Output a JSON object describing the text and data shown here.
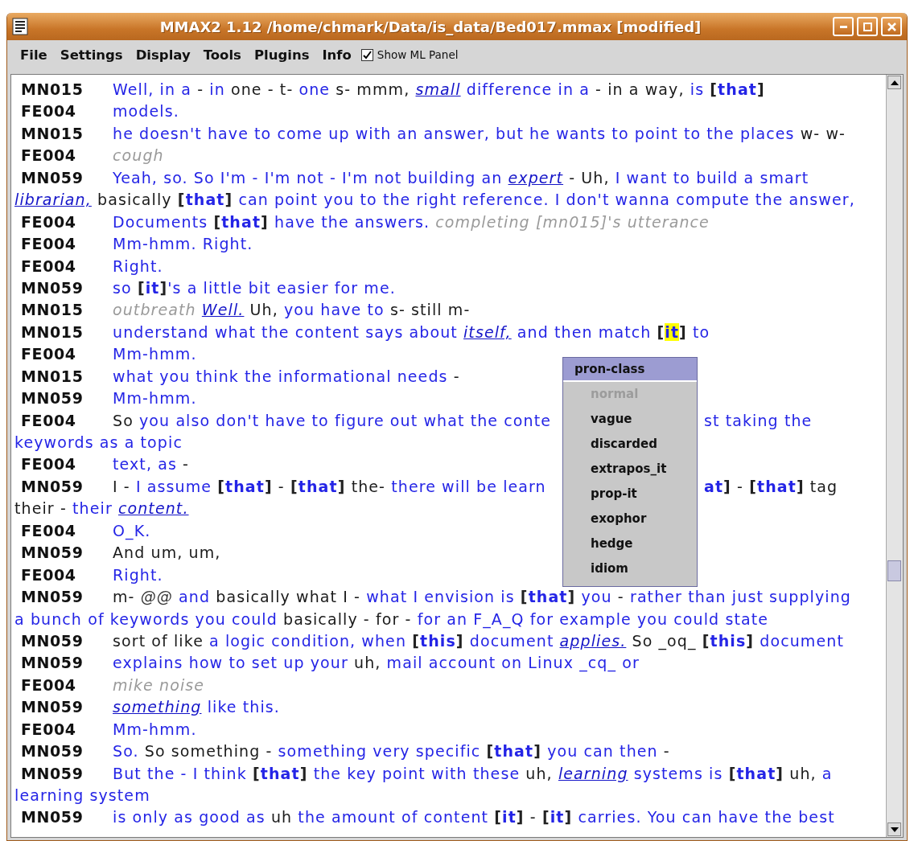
{
  "window": {
    "title": "MMAX2 1.12 /home/chmark/Data/is_data/Bed017.mmax [modified]"
  },
  "menu": [
    {
      "label": "File"
    },
    {
      "label": "Settings"
    },
    {
      "label": "Display"
    },
    {
      "label": "Tools"
    },
    {
      "label": "Plugins"
    },
    {
      "label": "Info"
    }
  ],
  "show_ml_panel": {
    "label": "Show ML Panel",
    "checked": true
  },
  "transcript": [
    {
      "speaker": "MN015",
      "segments": [
        {
          "kind": "speech",
          "text": "Well, in a"
        },
        {
          "kind": "other",
          "text": " - "
        },
        {
          "kind": "speech",
          "text": "in"
        },
        {
          "kind": "other",
          "text": " one - t- "
        },
        {
          "kind": "speech",
          "text": "one"
        },
        {
          "kind": "other",
          "text": " s- mmm, "
        },
        {
          "kind": "markable",
          "text": "small"
        },
        {
          "kind": "speech",
          "text": " difference in a"
        },
        {
          "kind": "other",
          "text": " - in a way,"
        },
        {
          "kind": "speech",
          "text": " is "
        },
        {
          "kind": "pronoun",
          "open": "[",
          "word": "that",
          "close": "]",
          "highlighted": false
        }
      ]
    },
    {
      "speaker": "FE004",
      "segments": [
        {
          "kind": "speech",
          "text": "models."
        }
      ]
    },
    {
      "speaker": "MN015",
      "segments": [
        {
          "kind": "speech",
          "text": "he doesn't have to come up with an answer, but he wants to point to the places"
        },
        {
          "kind": "other",
          "text": " w- w-"
        }
      ]
    },
    {
      "speaker": "FE004",
      "segments": [
        {
          "kind": "note",
          "text": "cough"
        }
      ]
    },
    {
      "speaker": "MN059",
      "segments": [
        {
          "kind": "speech",
          "text": "Yeah, so. So I'm - I'm not - I'm not building an "
        },
        {
          "kind": "markable",
          "text": "expert"
        },
        {
          "kind": "other",
          "text": " - Uh, "
        },
        {
          "kind": "speech",
          "text": "I want to build a smart"
        },
        {
          "kind": "break"
        },
        {
          "kind": "markable",
          "text": "librarian,"
        },
        {
          "kind": "other",
          "text": " basically "
        },
        {
          "kind": "pronoun",
          "open": "[",
          "word": "that",
          "close": "]",
          "highlighted": false
        },
        {
          "kind": "speech",
          "text": " can point you to the right reference. I don't wanna compute the answer,"
        }
      ]
    },
    {
      "speaker": "FE004",
      "segments": [
        {
          "kind": "speech",
          "text": "Documents "
        },
        {
          "kind": "pronoun",
          "open": "[",
          "word": "that",
          "close": "]",
          "highlighted": false
        },
        {
          "kind": "speech",
          "text": " have the answers. "
        },
        {
          "kind": "note",
          "text": "completing [mn015]'s utterance"
        }
      ]
    },
    {
      "speaker": "FE004",
      "segments": [
        {
          "kind": "speech",
          "text": "Mm-hmm. Right."
        }
      ]
    },
    {
      "speaker": "FE004",
      "segments": [
        {
          "kind": "speech",
          "text": "Right."
        }
      ]
    },
    {
      "speaker": "MN059",
      "segments": [
        {
          "kind": "speech",
          "text": "so "
        },
        {
          "kind": "pronoun",
          "open": "[",
          "word": "it",
          "close": "]",
          "highlighted": false
        },
        {
          "kind": "speech",
          "text": "'s a little bit easier for me."
        }
      ]
    },
    {
      "speaker": "MN015",
      "segments": [
        {
          "kind": "note",
          "text": "outbreath "
        },
        {
          "kind": "markable",
          "text": "Well."
        },
        {
          "kind": "other",
          "text": " Uh,"
        },
        {
          "kind": "speech",
          "text": " you have to"
        },
        {
          "kind": "other",
          "text": " s- still m-"
        }
      ]
    },
    {
      "speaker": "MN015",
      "segments": [
        {
          "kind": "speech",
          "text": "understand what the content says about "
        },
        {
          "kind": "markable",
          "text": "itself,"
        },
        {
          "kind": "speech",
          "text": " and then match "
        },
        {
          "kind": "pronoun",
          "open": "[",
          "word": "it",
          "close": "]",
          "highlighted": true
        },
        {
          "kind": "speech",
          "text": " to"
        }
      ]
    },
    {
      "speaker": "FE004",
      "segments": [
        {
          "kind": "speech",
          "text": "Mm-hmm."
        }
      ]
    },
    {
      "speaker": "MN015",
      "segments": [
        {
          "kind": "speech",
          "text": "what you think the informational needs"
        },
        {
          "kind": "other",
          "text": " -"
        }
      ]
    },
    {
      "speaker": "MN059",
      "segments": [
        {
          "kind": "speech",
          "text": "Mm-hmm."
        }
      ]
    },
    {
      "speaker": "FE004",
      "segments": [
        {
          "kind": "other",
          "text": "So"
        },
        {
          "kind": "speech",
          "text": " you also don't have to figure out what the conte"
        },
        {
          "kind": "gap"
        },
        {
          "kind": "speech",
          "text": "st taking the"
        },
        {
          "kind": "break"
        },
        {
          "kind": "speech",
          "text": "keywords as a topic"
        }
      ]
    },
    {
      "speaker": "FE004",
      "segments": [
        {
          "kind": "speech",
          "text": "text, as"
        },
        {
          "kind": "other",
          "text": " -"
        }
      ]
    },
    {
      "speaker": "MN059",
      "segments": [
        {
          "kind": "other",
          "text": "I - "
        },
        {
          "kind": "speech",
          "text": "I assume "
        },
        {
          "kind": "pronoun",
          "open": "[",
          "word": "that",
          "close": "]",
          "highlighted": false
        },
        {
          "kind": "other",
          "text": " - "
        },
        {
          "kind": "pronoun",
          "open": "[",
          "word": "that",
          "close": "]",
          "highlighted": false
        },
        {
          "kind": "other",
          "text": " the-"
        },
        {
          "kind": "speech",
          "text": " there will be learn"
        },
        {
          "kind": "gap"
        },
        {
          "kind": "pronoun",
          "word": "at",
          "close": "]",
          "highlighted": false
        },
        {
          "kind": "other",
          "text": " - "
        },
        {
          "kind": "pronoun",
          "open": "[",
          "word": "that",
          "close": "]",
          "highlighted": false
        },
        {
          "kind": "other",
          "text": " tag"
        },
        {
          "kind": "break"
        },
        {
          "kind": "other",
          "text": "their - "
        },
        {
          "kind": "speech",
          "text": "their "
        },
        {
          "kind": "markable",
          "text": "content."
        }
      ]
    },
    {
      "speaker": "FE004",
      "segments": [
        {
          "kind": "speech",
          "text": "O_K."
        }
      ]
    },
    {
      "speaker": "MN059",
      "segments": [
        {
          "kind": "other",
          "text": "And um, um,"
        }
      ]
    },
    {
      "speaker": "FE004",
      "segments": [
        {
          "kind": "speech",
          "text": "Right."
        }
      ]
    },
    {
      "speaker": "MN059",
      "segments": [
        {
          "kind": "other",
          "text": "m- "
        },
        {
          "kind": "aside",
          "text": "@@"
        },
        {
          "kind": "speech",
          "text": " and"
        },
        {
          "kind": "other",
          "text": " basically what I - "
        },
        {
          "kind": "speech",
          "text": "what I envision is "
        },
        {
          "kind": "pronoun",
          "open": "[",
          "word": "that",
          "close": "]",
          "highlighted": false
        },
        {
          "kind": "speech",
          "text": " you"
        },
        {
          "kind": "other",
          "text": " - "
        },
        {
          "kind": "speech",
          "text": "rather than just supplying"
        },
        {
          "kind": "break"
        },
        {
          "kind": "speech",
          "text": "a bunch of keywords you could"
        },
        {
          "kind": "other",
          "text": " basically - for - "
        },
        {
          "kind": "speech",
          "text": "for an F_A_Q for example you could state"
        }
      ]
    },
    {
      "speaker": "MN059",
      "segments": [
        {
          "kind": "other",
          "text": "sort of like "
        },
        {
          "kind": "speech",
          "text": "a logic condition, when "
        },
        {
          "kind": "pronoun",
          "open": "[",
          "word": "this",
          "close": "]",
          "highlighted": false
        },
        {
          "kind": "speech",
          "text": " document "
        },
        {
          "kind": "markable",
          "text": "applies."
        },
        {
          "kind": "other",
          "text": " So _oq_ "
        },
        {
          "kind": "pronoun",
          "open": "[",
          "word": "this",
          "close": "]",
          "highlighted": false
        },
        {
          "kind": "speech",
          "text": " document"
        }
      ]
    },
    {
      "speaker": "MN059",
      "segments": [
        {
          "kind": "speech",
          "text": "explains how to set up your"
        },
        {
          "kind": "other",
          "text": " uh, "
        },
        {
          "kind": "speech",
          "text": "mail account on Linux _cq_ or"
        }
      ]
    },
    {
      "speaker": "FE004",
      "segments": [
        {
          "kind": "note",
          "text": "mike noise"
        }
      ]
    },
    {
      "speaker": "MN059",
      "segments": [
        {
          "kind": "markable",
          "text": "something"
        },
        {
          "kind": "speech",
          "text": " like this."
        }
      ]
    },
    {
      "speaker": "FE004",
      "segments": [
        {
          "kind": "speech",
          "text": "Mm-hmm."
        }
      ]
    },
    {
      "speaker": "MN059",
      "segments": [
        {
          "kind": "speech",
          "text": "So."
        },
        {
          "kind": "other",
          "text": " So something - "
        },
        {
          "kind": "speech",
          "text": "something very specific "
        },
        {
          "kind": "pronoun",
          "open": "[",
          "word": "that",
          "close": "]",
          "highlighted": false
        },
        {
          "kind": "speech",
          "text": " you can then"
        },
        {
          "kind": "other",
          "text": " -"
        }
      ]
    },
    {
      "speaker": "MN059",
      "segments": [
        {
          "kind": "speech",
          "text": "But the - I think "
        },
        {
          "kind": "pronoun",
          "open": "[",
          "word": "that",
          "close": "]",
          "highlighted": false
        },
        {
          "kind": "speech",
          "text": " the key point with these"
        },
        {
          "kind": "other",
          "text": " uh, "
        },
        {
          "kind": "markable",
          "text": "learning"
        },
        {
          "kind": "speech",
          "text": " systems is "
        },
        {
          "kind": "pronoun",
          "open": "[",
          "word": "that",
          "close": "]",
          "highlighted": false
        },
        {
          "kind": "other",
          "text": " uh,"
        },
        {
          "kind": "speech",
          "text": " a"
        },
        {
          "kind": "break"
        },
        {
          "kind": "speech",
          "text": "learning system"
        }
      ]
    },
    {
      "speaker": "MN059",
      "segments": [
        {
          "kind": "speech",
          "text": "is only as good as"
        },
        {
          "kind": "other",
          "text": " uh "
        },
        {
          "kind": "speech",
          "text": "the amount of content "
        },
        {
          "kind": "pronoun",
          "open": "[",
          "word": "it",
          "close": "]",
          "highlighted": false
        },
        {
          "kind": "other",
          "text": " - "
        },
        {
          "kind": "pronoun",
          "open": "[",
          "word": "it",
          "close": "]",
          "highlighted": false
        },
        {
          "kind": "speech",
          "text": " carries. You can have the best"
        }
      ]
    }
  ],
  "popup": {
    "title": "pron-class",
    "items": [
      {
        "label": "normal",
        "disabled": true
      },
      {
        "label": "vague",
        "disabled": false
      },
      {
        "label": "discarded",
        "disabled": false
      },
      {
        "label": "extrapos_it",
        "disabled": false
      },
      {
        "label": "prop-it",
        "disabled": false
      },
      {
        "label": "exophor",
        "disabled": false
      },
      {
        "label": "hedge",
        "disabled": false
      },
      {
        "label": "idiom",
        "disabled": false
      }
    ]
  }
}
